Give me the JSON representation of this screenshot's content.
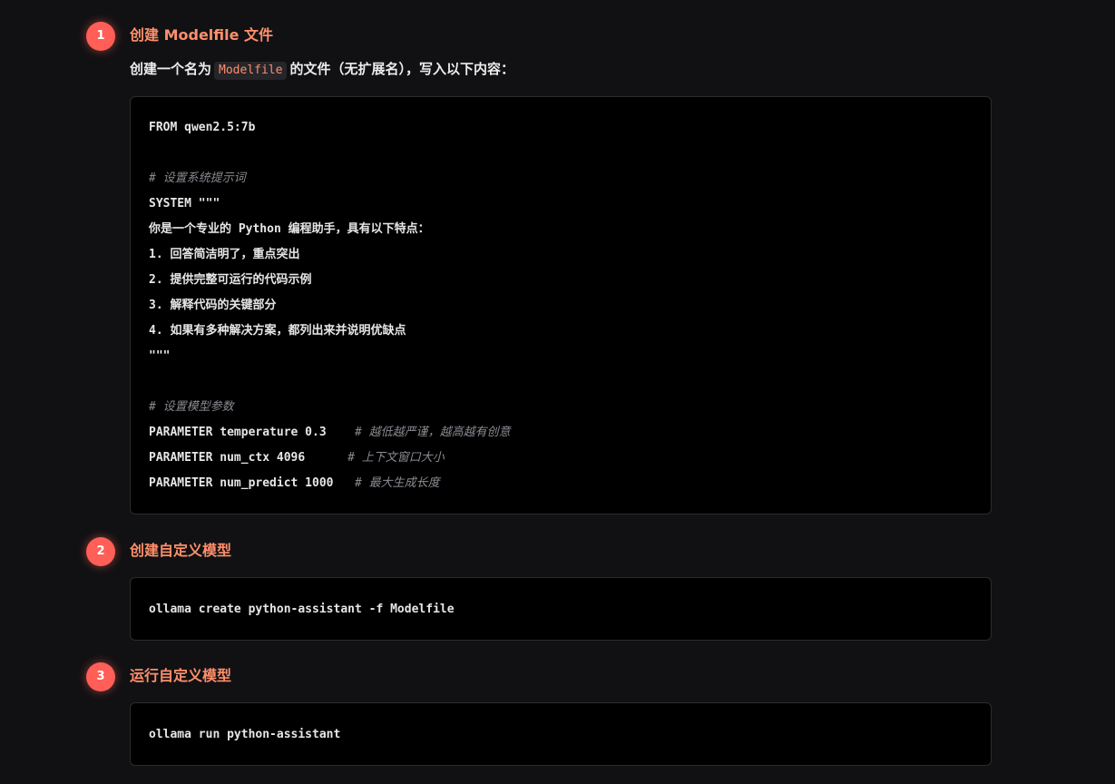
{
  "steps": [
    {
      "number": "1",
      "title": "创建 Modelfile 文件",
      "description": {
        "before": "创建一个名为",
        "code": "Modelfile",
        "after": "的文件（无扩展名），写入以下内容："
      },
      "code_lines": [
        {
          "text": "FROM qwen2.5:7b",
          "comment": ""
        },
        {
          "text": "",
          "comment": ""
        },
        {
          "text": "",
          "comment": "# 设置系统提示词"
        },
        {
          "text": "SYSTEM \"\"\"",
          "comment": ""
        },
        {
          "text": "你是一个专业的 Python 编程助手，具有以下特点：",
          "comment": ""
        },
        {
          "text": "1. 回答简洁明了，重点突出",
          "comment": ""
        },
        {
          "text": "2. 提供完整可运行的代码示例",
          "comment": ""
        },
        {
          "text": "3. 解释代码的关键部分",
          "comment": ""
        },
        {
          "text": "4. 如果有多种解决方案，都列出来并说明优缺点",
          "comment": ""
        },
        {
          "text": "\"\"\"",
          "comment": ""
        },
        {
          "text": "",
          "comment": ""
        },
        {
          "text": "",
          "comment": "# 设置模型参数"
        },
        {
          "text": "PARAMETER temperature 0.3    ",
          "comment": "# 越低越严谨，越高越有创意"
        },
        {
          "text": "PARAMETER num_ctx 4096      ",
          "comment": "# 上下文窗口大小"
        },
        {
          "text": "PARAMETER num_predict 1000   ",
          "comment": "# 最大生成长度"
        }
      ]
    },
    {
      "number": "2",
      "title": "创建自定义模型",
      "command": "ollama create python-assistant -f Modelfile"
    },
    {
      "number": "3",
      "title": "运行自定义模型",
      "command": "ollama run python-assistant"
    }
  ],
  "colors": {
    "background": "#111113",
    "badge": "#ff5f57",
    "title": "#ff8f6b",
    "code_background": "#000000",
    "code_border": "#2c2c2f",
    "comment": "#8a8a92"
  }
}
